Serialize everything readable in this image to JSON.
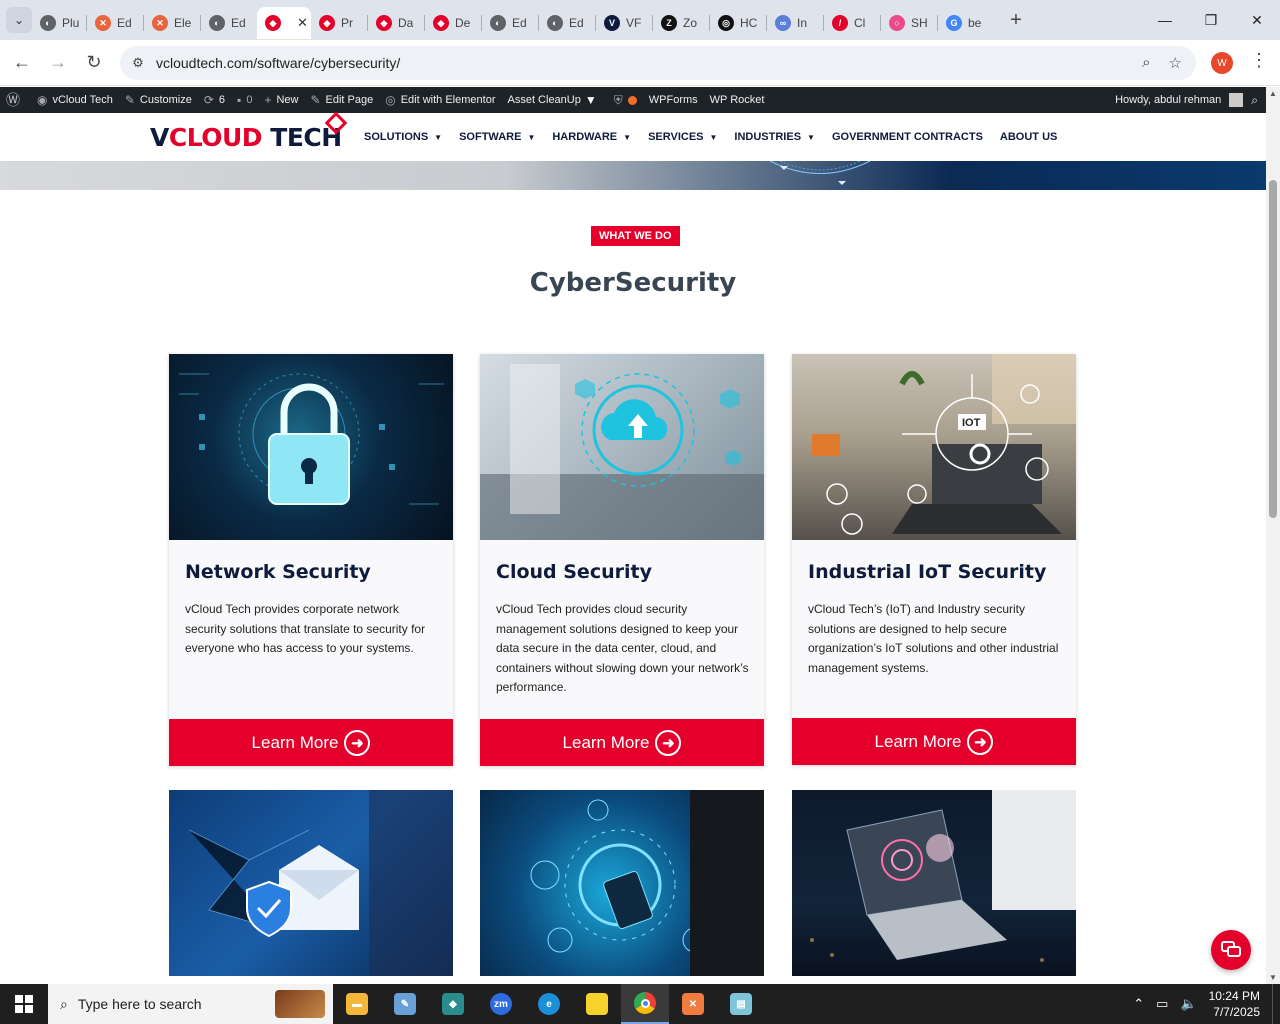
{
  "browser": {
    "tabs": [
      {
        "label": "Plu",
        "fav_color": "#5f6368",
        "fav_glyph": "◐"
      },
      {
        "label": "Ed",
        "fav_color": "#e8643c",
        "fav_glyph": "✕"
      },
      {
        "label": "Ele",
        "fav_color": "#e8643c",
        "fav_glyph": "✕"
      },
      {
        "label": "Ed",
        "fav_color": "#5f6368",
        "fav_glyph": "◐"
      },
      {
        "label": "",
        "fav_color": "#e4002b",
        "fav_glyph": "◆",
        "active": true
      },
      {
        "label": "Pr",
        "fav_color": "#e4002b",
        "fav_glyph": "◆"
      },
      {
        "label": "Da",
        "fav_color": "#e4002b",
        "fav_glyph": "◆"
      },
      {
        "label": "De",
        "fav_color": "#e4002b",
        "fav_glyph": "◆"
      },
      {
        "label": "Ed",
        "fav_color": "#5f6368",
        "fav_glyph": "◐"
      },
      {
        "label": "Ed",
        "fav_color": "#5f6368",
        "fav_glyph": "◐"
      },
      {
        "label": "VF",
        "fav_color": "#0f1b3d",
        "fav_glyph": "V"
      },
      {
        "label": "Zo",
        "fav_color": "#111111",
        "fav_glyph": "Z"
      },
      {
        "label": "HC",
        "fav_color": "#111111",
        "fav_glyph": "◎"
      },
      {
        "label": "In",
        "fav_color": "#5b7fd6",
        "fav_glyph": "∞"
      },
      {
        "label": "Cl",
        "fav_color": "#e4002b",
        "fav_glyph": "/"
      },
      {
        "label": "SH",
        "fav_color": "#e94b8a",
        "fav_glyph": "○"
      },
      {
        "label": "be",
        "fav_color": "#4285f4",
        "fav_glyph": "G"
      }
    ],
    "active_close": "✕",
    "new_tab": "+",
    "url": "vcloudtech.com/software/cybersecurity/",
    "profile_initial": "W"
  },
  "wpbar": {
    "site": "vCloud Tech",
    "customize": "Customize",
    "updates": "6",
    "comments": "0",
    "new": "New",
    "edit_page": "Edit Page",
    "elementor": "Edit with Elementor",
    "cleanup": "Asset CleanUp",
    "wpforms": "WPForms",
    "rocket": "WP Rocket",
    "howdy": "Howdy, abdul rehman"
  },
  "site": {
    "logo_v": "V",
    "logo_cloud": "CLOUD",
    "logo_tech": " TECH",
    "nav": [
      {
        "label": "SOLUTIONS",
        "dropdown": true
      },
      {
        "label": "SOFTWARE",
        "dropdown": true
      },
      {
        "label": "HARDWARE",
        "dropdown": true
      },
      {
        "label": "SERVICES",
        "dropdown": true
      },
      {
        "label": "INDUSTRIES",
        "dropdown": true
      },
      {
        "label": "GOVERNMENT CONTRACTS",
        "dropdown": false
      },
      {
        "label": "ABOUT US",
        "dropdown": false
      }
    ]
  },
  "section": {
    "badge": "WHAT WE DO",
    "title": "CyberSecurity"
  },
  "cards": [
    {
      "title": "Network Security",
      "text": "vCloud Tech provides corporate network security solutions that translate to security for everyone who has access to your systems.",
      "button": "Learn More",
      "image_icon": "padlock-icon"
    },
    {
      "title": "Cloud Security",
      "text": "vCloud Tech provides cloud security management solutions designed to keep your data secure in the data center, cloud, and containers without slowing down your network’s performance.",
      "button": "Learn More",
      "image_icon": "cloud-upload-icon"
    },
    {
      "title": "Industrial IoT Security",
      "text": "vCloud Tech’s  (IoT) and Industry security solutions are designed to help secure organization’s IoT solutions and other industrial management systems.",
      "button": "Learn More",
      "image_icon": "iot-gear-icon",
      "image_label": "IOT"
    }
  ],
  "taskbar": {
    "search_placeholder": "Type here to search",
    "time": "10:24 PM",
    "date": "7/7/2025"
  },
  "colors": {
    "brand_red": "#e4002b",
    "brand_navy": "#0f1b3d"
  }
}
